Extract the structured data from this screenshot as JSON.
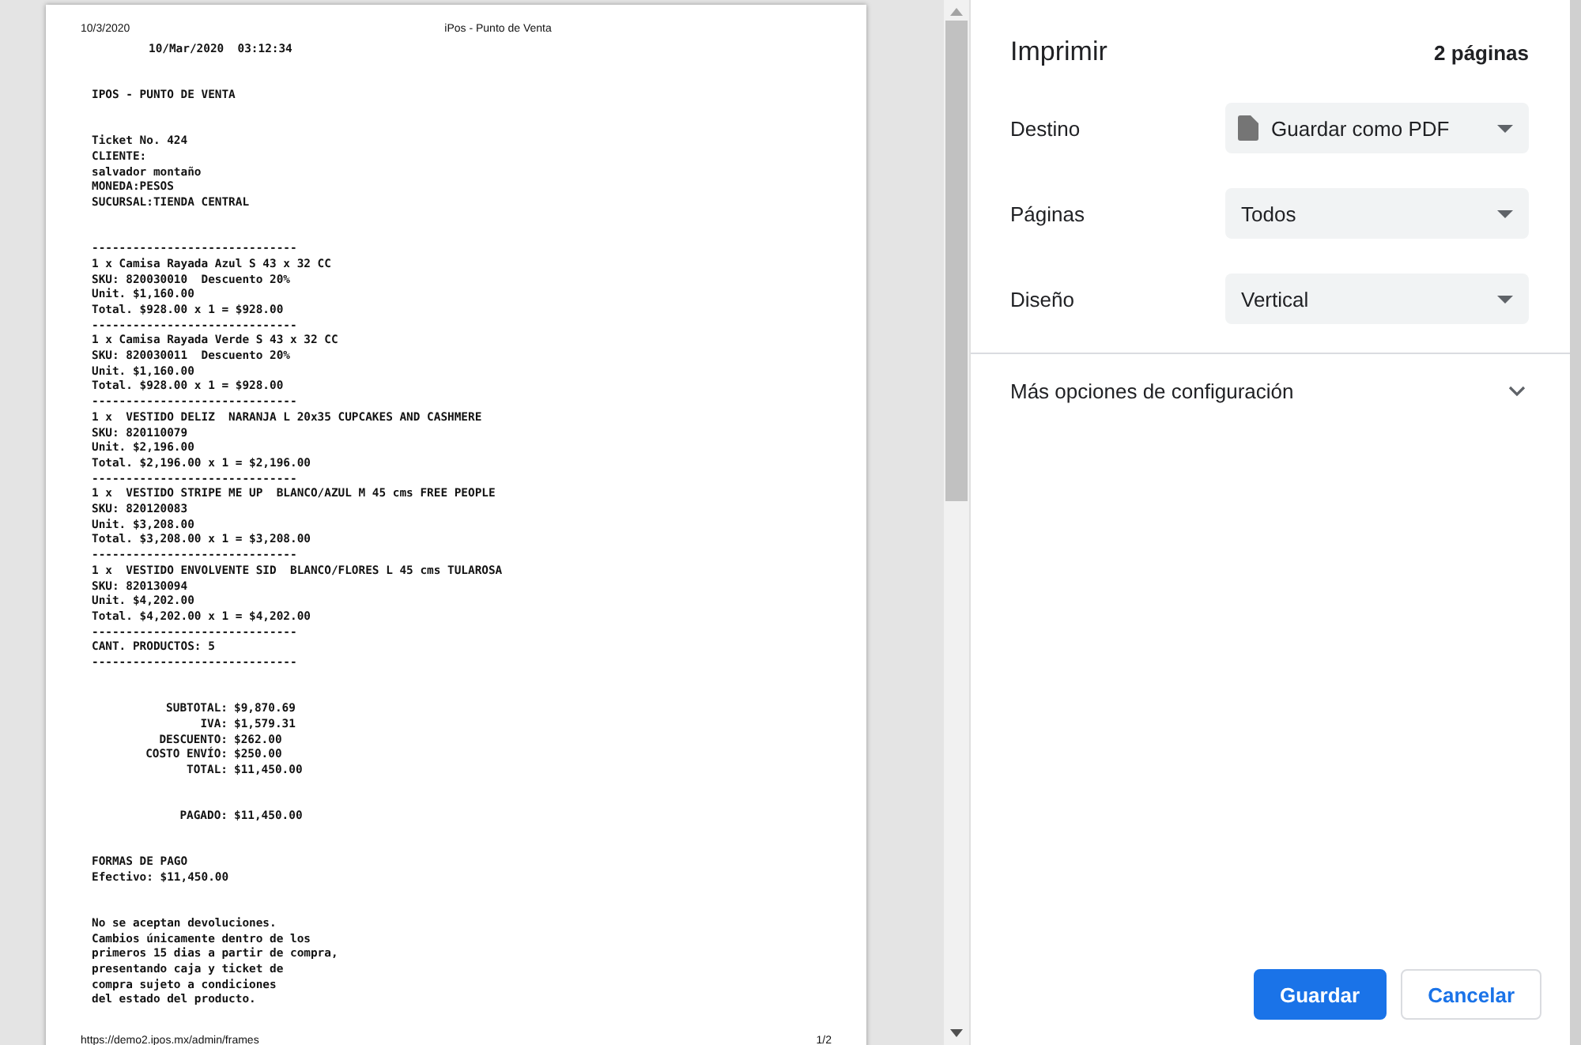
{
  "preview": {
    "header_date": "10/3/2020",
    "header_title": "iPos - Punto de Venta",
    "blocks": [
      {
        "kind": "indent",
        "lines": [
          "10/Mar/2020  03:12:34"
        ]
      },
      {
        "kind": "plain",
        "lines": [
          "IPOS - PUNTO DE VENTA"
        ]
      },
      {
        "kind": "plain",
        "lines": [
          "Ticket No. 424",
          "CLIENTE:",
          "salvador montaño",
          "MONEDA:PESOS",
          "SUCURSAL:TIENDA CENTRAL"
        ]
      },
      {
        "kind": "plain",
        "lines": [
          "------------------------------",
          "1 x Camisa Rayada Azul S 43 x 32 CC",
          "SKU: 820030010  Descuento 20%",
          "Unit. $1,160.00",
          "Total. $928.00 x 1 = $928.00",
          "------------------------------",
          "1 x Camisa Rayada Verde S 43 x 32 CC",
          "SKU: 820030011  Descuento 20%",
          "Unit. $1,160.00",
          "Total. $928.00 x 1 = $928.00",
          "------------------------------",
          "1 x  VESTIDO DELIZ  NARANJA L 20x35 CUPCAKES AND CASHMERE",
          "SKU: 820110079",
          "Unit. $2,196.00",
          "Total. $2,196.00 x 1 = $2,196.00",
          "------------------------------",
          "1 x  VESTIDO STRIPE ME UP  BLANCO/AZUL M 45 cms FREE PEOPLE",
          "SKU: 820120083",
          "Unit. $3,208.00",
          "Total. $3,208.00 x 1 = $3,208.00",
          "------------------------------",
          "1 x  VESTIDO ENVOLVENTE SID  BLANCO/FLORES L 45 cms TULAROSA",
          "SKU: 820130094",
          "Unit. $4,202.00",
          "Total. $4,202.00 x 1 = $4,202.00",
          "------------------------------",
          "CANT. PRODUCTOS: 5",
          "------------------------------"
        ]
      },
      {
        "kind": "totals",
        "rows": [
          {
            "label": "SUBTOTAL:",
            "value": "$9,870.69"
          },
          {
            "label": "IVA:",
            "value": "$1,579.31"
          },
          {
            "label": "DESCUENTO:",
            "value": "$262.00"
          },
          {
            "label": "COSTO ENVÍO:",
            "value": "$250.00"
          },
          {
            "label": "TOTAL:",
            "value": "$11,450.00"
          }
        ]
      },
      {
        "kind": "totals",
        "rows": [
          {
            "label": "PAGADO:",
            "value": "$11,450.00"
          }
        ]
      },
      {
        "kind": "plain",
        "lines": [
          "FORMAS DE PAGO",
          "Efectivo: $11,450.00"
        ]
      },
      {
        "kind": "plain",
        "lines": [
          "No se aceptan devoluciones.",
          "Cambios únicamente dentro de los",
          "primeros 15 dias a partir de compra,",
          "presentando caja y ticket de",
          "compra sujeto a condiciones",
          "del estado del producto."
        ]
      }
    ],
    "footer_url": "https://demo2.ipos.mx/admin/frames",
    "footer_page": "1/2"
  },
  "panel": {
    "title": "Imprimir",
    "page_count": "2 páginas",
    "settings": [
      {
        "label": "Destino",
        "value": "Guardar como PDF",
        "kind": "destination"
      },
      {
        "label": "Páginas",
        "value": "Todos",
        "kind": "select"
      },
      {
        "label": "Diseño",
        "value": "Vertical",
        "kind": "select"
      }
    ],
    "more_options": {
      "label": "Más opciones de configuración",
      "expanded": false
    },
    "buttons": [
      {
        "label": "Guardar",
        "kind": "primary"
      },
      {
        "label": "Cancelar",
        "kind": "secondary"
      }
    ]
  }
}
